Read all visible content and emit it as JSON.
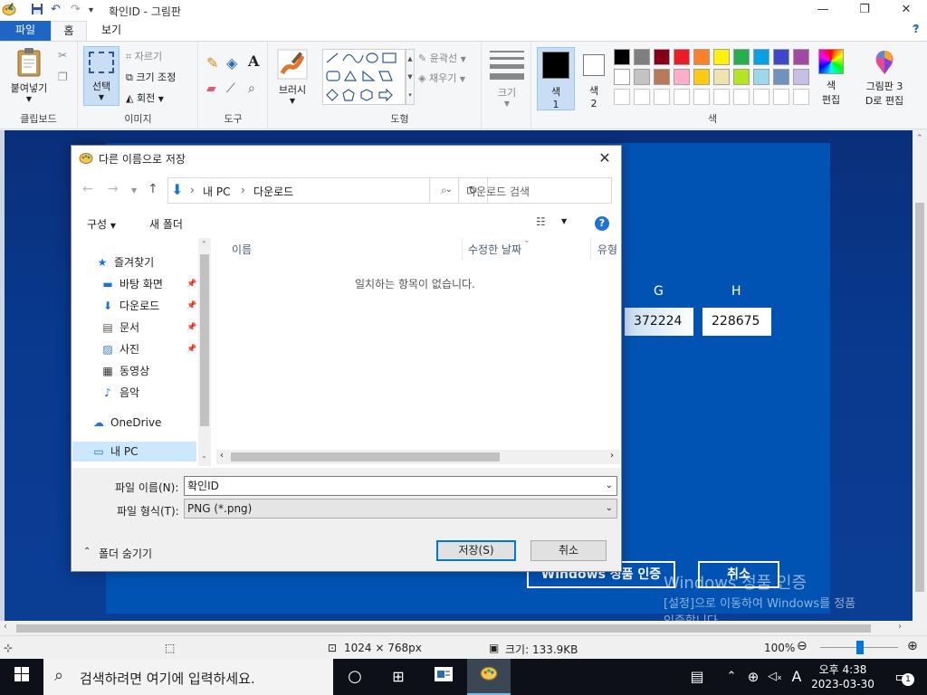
{
  "window": {
    "title": "확인ID - 그림판",
    "minimize": "—",
    "maximize": "❐",
    "close": "✕"
  },
  "ribbon": {
    "tabs": [
      {
        "label": "파일"
      },
      {
        "label": "홈"
      },
      {
        "label": "보기"
      }
    ],
    "clipboard": {
      "paste": "붙여넣기",
      "label": "클립보드"
    },
    "image": {
      "select": "선택",
      "crop": "자르기",
      "resize": "크기 조정",
      "rotate": "회전",
      "label": "이미지"
    },
    "tools": {
      "label": "도구"
    },
    "brushes": {
      "label": "브러시"
    },
    "shapes": {
      "outline": "윤곽선",
      "fill": "채우기",
      "label": "도형"
    },
    "size": {
      "label": "크기"
    },
    "color1": {
      "label1": "색",
      "label2": "1"
    },
    "color2": {
      "label1": "색",
      "label2": "2"
    },
    "colors": {
      "label": "색"
    },
    "edit_colors": {
      "line1": "색",
      "line2": "편집"
    },
    "paint3d": {
      "line1": "그림판 3",
      "line2": "D로 편집"
    }
  },
  "palette": {
    "row1": [
      "#000000",
      "#7f7f7f",
      "#880015",
      "#ed1c24",
      "#ff7f27",
      "#fff200",
      "#22b14c",
      "#00a2e8",
      "#3f48cc",
      "#a349a4"
    ],
    "row2": [
      "#ffffff",
      "#c3c3c3",
      "#b97a57",
      "#ffaec9",
      "#ffc90e",
      "#efe4b0",
      "#b5e61d",
      "#99d9ea",
      "#7092be",
      "#c8bfe7"
    ],
    "color1": "#000000",
    "color2": "#ffffff"
  },
  "canvas_content": {
    "col_g": "G",
    "col_h": "H",
    "code_g": "372224",
    "code_h": "228675",
    "activate_button": "Windows 정품 인증",
    "cancel_button": "취소",
    "watermark_line1": "Windows 정품 인증",
    "watermark_line2": "[설정]으로 이동하여 Windows를 정품",
    "watermark_line3": "인증합니다."
  },
  "statusbar": {
    "dimensions": "1024 × 768px",
    "size": "크기: 133.9KB",
    "zoom": "100%"
  },
  "taskbar": {
    "search_placeholder": "검색하려면 여기에 입력하세요.",
    "time": "오후 4:38",
    "date": "2023-03-30",
    "ime": "A",
    "notification_count": "1"
  },
  "dialog": {
    "title": "다른 이름으로 저장",
    "address": {
      "root": "내 PC",
      "folder": "다운로드"
    },
    "search_placeholder": "다운로드 검색",
    "organize": "구성",
    "new_folder": "새 폴더",
    "nav": {
      "quick_access": "즐겨찾기",
      "items": [
        {
          "label": "바탕 화면",
          "pinned": true
        },
        {
          "label": "다운로드",
          "pinned": true
        },
        {
          "label": "문서",
          "pinned": true
        },
        {
          "label": "사진",
          "pinned": true
        },
        {
          "label": "동영상",
          "pinned": false
        },
        {
          "label": "음악",
          "pinned": false
        }
      ],
      "onedrive": "OneDrive",
      "this_pc": "내 PC"
    },
    "columns": {
      "name": "이름",
      "modified": "수정한 날짜",
      "type": "유형"
    },
    "empty_message": "일치하는 항목이 없습니다.",
    "filename_label": "파일 이름(N):",
    "filename_value": "확인ID",
    "filetype_label": "파일 형식(T):",
    "filetype_value": "PNG (*.png)",
    "hide_folders": "폴더 숨기기",
    "save_button": "저장(S)",
    "cancel_button": "취소"
  }
}
